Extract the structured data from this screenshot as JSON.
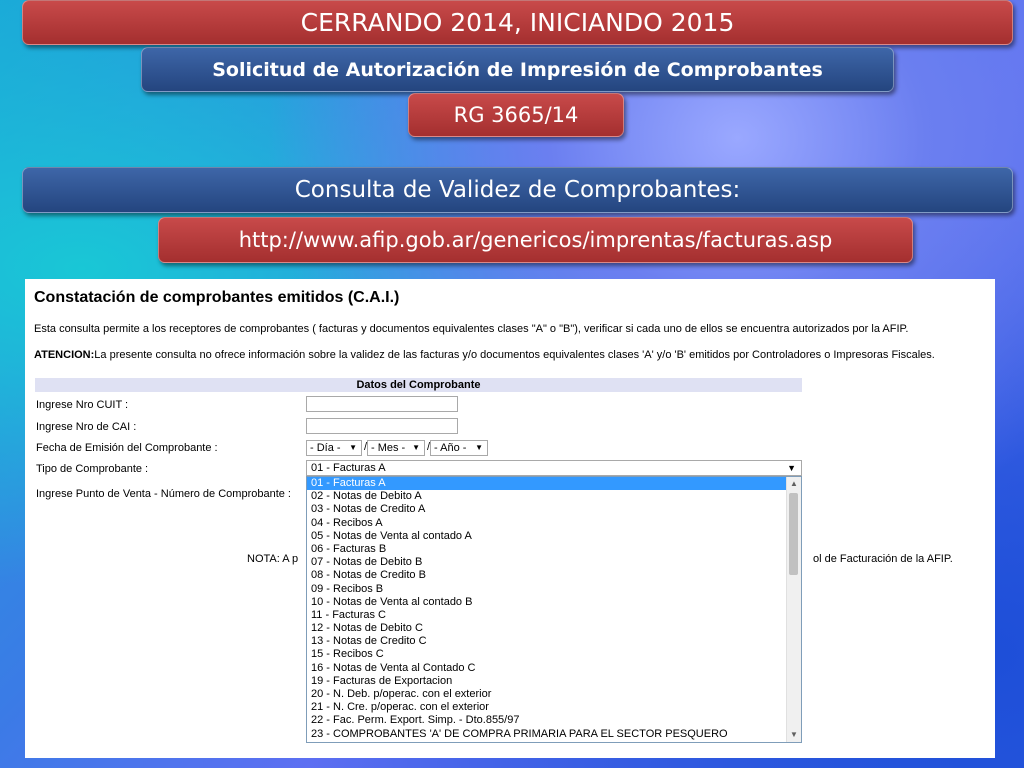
{
  "slide": {
    "title": "CERRANDO 2014, INICIANDO 2015",
    "subtitle": "Solicitud de Autorización de Impresión de Comprobantes",
    "resolution": "RG 3665/14",
    "consulta_heading": "Consulta de Validez de Comprobantes:",
    "url": "http://www.afip.gob.ar/genericos/imprentas/facturas.asp"
  },
  "page": {
    "title": "Constatación de comprobantes emitidos (C.A.I.)",
    "description": "Esta consulta permite a los receptores de comprobantes ( facturas y documentos equivalentes clases \"A\" o \"B\"), verificar si cada uno de ellos se encuentra autorizados por la AFIP.",
    "atencion_label": "ATENCION:",
    "atencion_text": "La presente consulta no ofrece información sobre la validez de las facturas y/o documentos equivalentes clases 'A' y/o 'B' emitidos por Controladores o Impresoras Fiscales.",
    "form": {
      "header": "Datos del Comprobante",
      "cuit_label": "Ingrese Nro CUIT :",
      "cai_label": "Ingrese Nro de CAI :",
      "fecha_label": "Fecha de Emisión del Comprobante :",
      "dia": "- Día -",
      "mes": "- Mes -",
      "anio": "- Año -",
      "date_sep": "/",
      "tipo_label": "Tipo de Comprobante :",
      "tipo_value": "01 - Facturas A",
      "punto_label": "Ingrese Punto de Venta - Número de Comprobante :",
      "nota_start": "NOTA: A p",
      "nota_end": "ol de Facturación de la AFIP."
    },
    "dropdown_options": [
      "01 - Facturas A",
      "02 - Notas de Debito A",
      "03 - Notas de Credito A",
      "04 - Recibos A",
      "05 - Notas de Venta al contado A",
      "06 - Facturas B",
      "07 - Notas de Debito B",
      "08 - Notas de Credito B",
      "09 - Recibos B",
      "10 - Notas de Venta al contado B",
      "11 - Facturas C",
      "12 - Notas de Debito C",
      "13 - Notas de Credito C",
      "15 - Recibos C",
      "16 - Notas de Venta al Contado C",
      "19 - Facturas de Exportacion",
      "20 - N. Deb. p/operac. con el exterior",
      "21 - N. Cre. p/operac. con el exterior",
      "22 - Fac. Perm. Export. Simp. - Dto.855/97",
      "23 - COMPROBANTES 'A' DE COMPRA PRIMARIA PARA EL SECTOR PESQUERO"
    ],
    "selected_index": 0
  },
  "icons": {
    "dropdown_arrow": "triangle-down-icon",
    "scroll_up": "triangle-up-icon",
    "scroll_down": "triangle-down-icon"
  },
  "colors": {
    "banner_red": "#b63c3c",
    "banner_blue": "#2f5694",
    "selected_option": "#3399ff",
    "form_header_bg": "#dfe1f3"
  }
}
